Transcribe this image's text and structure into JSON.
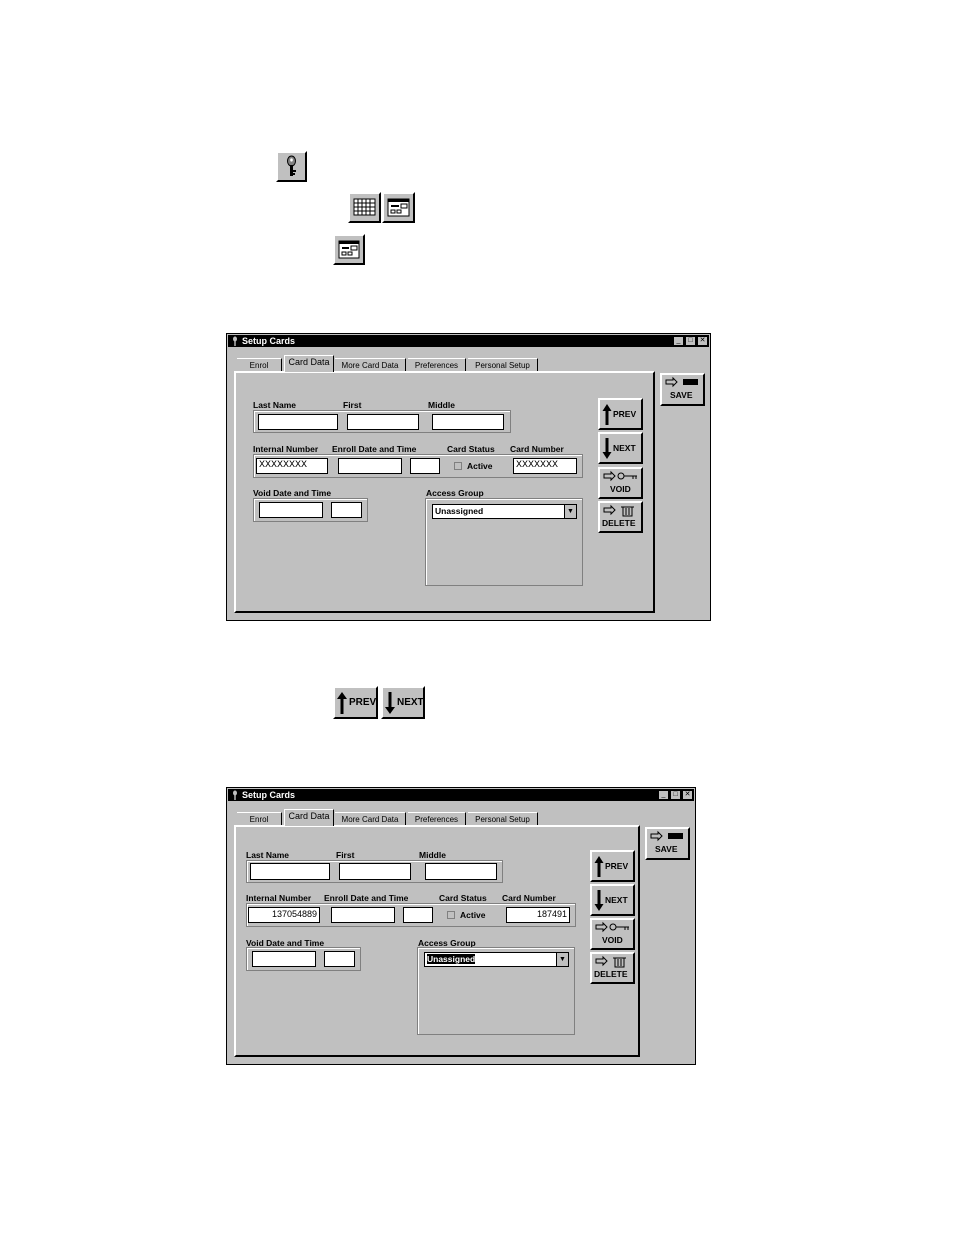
{
  "toolbar_icons": {
    "key": "key-icon",
    "grid_view": "grid-view-icon",
    "form_view": "form-view-icon",
    "prev_label": "PREV",
    "next_label": "NEXT"
  },
  "window1": {
    "title": "Setup Cards",
    "tabs": [
      "Enrol",
      "Card Data",
      "More Card Data",
      "Preferences",
      "Personal Setup"
    ],
    "active_tab": "Card Data",
    "labels": {
      "last_name": "Last Name",
      "first": "First",
      "middle": "Middle",
      "internal_number": "Internal Number",
      "enroll_date": "Enroll Date and Time",
      "card_status": "Card Status",
      "card_number": "Card Number",
      "void_date": "Void Date and Time",
      "access_group": "Access Group",
      "active": "Active"
    },
    "values": {
      "last_name": "",
      "first": "",
      "middle": "",
      "internal_number": "XXXXXXXX",
      "enroll_date": "",
      "enroll_time": "",
      "card_number": "XXXXXXX",
      "void_date": "",
      "void_time": "",
      "access_group": "Unassigned"
    },
    "buttons": {
      "prev": "PREV",
      "next": "NEXT",
      "void": "VOID",
      "delete": "DELETE",
      "save": "SAVE"
    }
  },
  "window2": {
    "title": "Setup Cards",
    "tabs": [
      "Enrol",
      "Card Data",
      "More Card Data",
      "Preferences",
      "Personal Setup"
    ],
    "active_tab": "Card Data",
    "labels": {
      "last_name": "Last Name",
      "first": "First",
      "middle": "Middle",
      "internal_number": "Internal Number",
      "enroll_date": "Enroll Date and Time",
      "card_status": "Card Status",
      "card_number": "Card Number",
      "void_date": "Void Date and Time",
      "access_group": "Access Group",
      "active": "Active"
    },
    "values": {
      "last_name": "",
      "first": "",
      "middle": "",
      "internal_number": "137054889",
      "enroll_date": "",
      "enroll_time": "",
      "card_number": "187491",
      "void_date": "",
      "void_time": "",
      "access_group": "Unassigned"
    },
    "buttons": {
      "prev": "PREV",
      "next": "NEXT",
      "void": "VOID",
      "delete": "DELETE",
      "save": "SAVE"
    }
  }
}
